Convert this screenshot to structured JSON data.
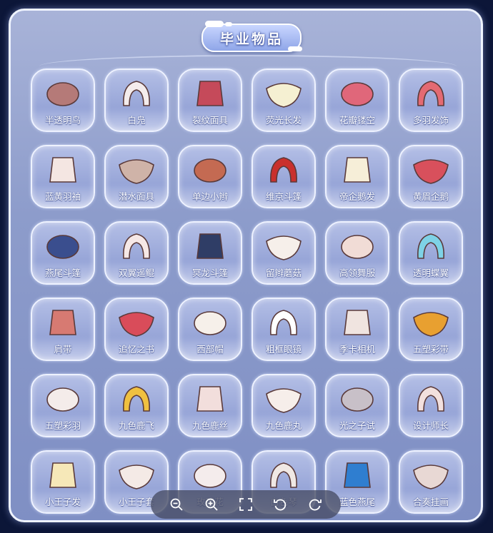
{
  "title": "毕业物品",
  "items": [
    {
      "label": "半透明鸟",
      "icon": "translucent-bird-mask-icon",
      "color": "#b57a78"
    },
    {
      "label": "白凫",
      "icon": "white-duck-hair-icon",
      "color": "#f4ecec"
    },
    {
      "label": "裂纹面具",
      "icon": "cracked-mask-icon",
      "color": "#c54a5a"
    },
    {
      "label": "荧光长发",
      "icon": "glowing-long-hair-icon",
      "color": "#f5f0d2"
    },
    {
      "label": "花瓣镂空",
      "icon": "petal-hollow-headpiece-icon",
      "color": "#e0677a"
    },
    {
      "label": "多羽发饰",
      "icon": "feather-hair-accessory-icon",
      "color": "#e46a72"
    },
    {
      "label": "蓝黄羽袖",
      "icon": "blue-yellow-feather-outfit-icon",
      "color": "#f4e6e2"
    },
    {
      "label": "潜水面具",
      "icon": "diving-mask-icon",
      "color": "#cfb3a8"
    },
    {
      "label": "单边小辫",
      "icon": "single-braid-icon",
      "color": "#c46a52"
    },
    {
      "label": "维京斗篷",
      "icon": "viking-cape-icon",
      "color": "#c9302c"
    },
    {
      "label": "帝企鹅发",
      "icon": "emperor-penguin-hair-icon",
      "color": "#f6eed8"
    },
    {
      "label": "黄眉企鹅",
      "icon": "yellow-brow-penguin-mask-icon",
      "color": "#d8505c"
    },
    {
      "label": "燕尾斗篷",
      "icon": "swallowtail-cape-icon",
      "color": "#3a4e8e"
    },
    {
      "label": "双翼遥鲲",
      "icon": "double-wing-cape-icon",
      "color": "#f6e8e6"
    },
    {
      "label": "冥龙斗篷",
      "icon": "krill-cape-icon",
      "color": "#2f3d66"
    },
    {
      "label": "留辫蘑菇",
      "icon": "braided-mushroom-hair-icon",
      "color": "#f6efea"
    },
    {
      "label": "高领舞服",
      "icon": "high-collar-dress-icon",
      "color": "#f1dcd6"
    },
    {
      "label": "透明蝶翼",
      "icon": "translucent-butterfly-wing-icon",
      "color": "#7ed2e6"
    },
    {
      "label": "肩带",
      "icon": "shoulder-strap-icon",
      "color": "#d77a72"
    },
    {
      "label": "追忆之书",
      "icon": "memory-book-icon",
      "color": "#d94c5a"
    },
    {
      "label": "西部帽",
      "icon": "western-hat-icon",
      "color": "#f6f0ea"
    },
    {
      "label": "粗框眼镜",
      "icon": "thick-frame-glasses-icon",
      "color": "#ffffff"
    },
    {
      "label": "季卡相机",
      "icon": "season-camera-icon",
      "color": "#f0e4e0"
    },
    {
      "label": "五塑彩带",
      "icon": "five-color-ribbon-icon",
      "color": "#e8a030"
    },
    {
      "label": "五塑彩羽",
      "icon": "five-color-feather-hair-icon",
      "color": "#f4ecea"
    },
    {
      "label": "九色鹿飞",
      "icon": "nine-color-deer-flying-icon",
      "color": "#f0c040"
    },
    {
      "label": "九色鹿丝",
      "icon": "nine-color-deer-silk-outfit-icon",
      "color": "#f2dedc"
    },
    {
      "label": "九色鹿丸",
      "icon": "nine-color-deer-bun-hair-icon",
      "color": "#f6eeea"
    },
    {
      "label": "光之子试",
      "icon": "child-of-light-prop-icon",
      "color": "#c8c0c8"
    },
    {
      "label": "设计师长",
      "icon": "designer-outfit-icon",
      "color": "#f2e0de"
    },
    {
      "label": "小王子发",
      "icon": "little-prince-hair-icon",
      "color": "#f6e8b8"
    },
    {
      "label": "小王子套",
      "icon": "little-prince-outfit-icon",
      "color": "#f4eae6"
    },
    {
      "label": "玫瑰花",
      "icon": "rose-flower-icon",
      "color": "#f4ecec"
    },
    {
      "label": "白色琴",
      "icon": "white-piano-icon",
      "color": "#f0e8e4"
    },
    {
      "label": "蓝色燕尾",
      "icon": "blue-swallowtail-cape-icon",
      "color": "#2f7ed0"
    },
    {
      "label": "合奏挂画",
      "icon": "ensemble-painting-icon",
      "color": "#e8d8d4"
    }
  ],
  "toolbar": [
    {
      "name": "zoom-out-icon"
    },
    {
      "name": "zoom-in-icon"
    },
    {
      "name": "fullscreen-icon"
    },
    {
      "name": "rotate-left-icon"
    },
    {
      "name": "rotate-right-icon"
    }
  ]
}
